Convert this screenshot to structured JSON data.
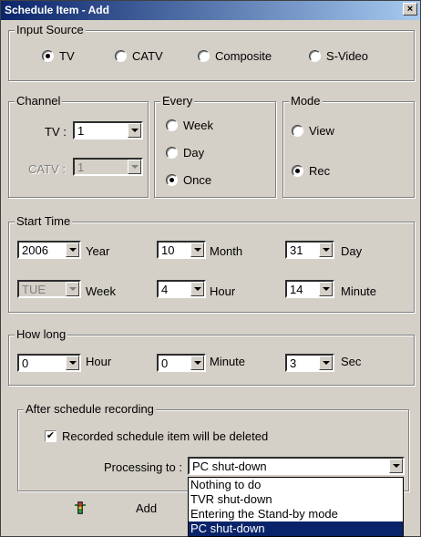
{
  "window": {
    "title": "Schedule Item - Add",
    "close_label": "×"
  },
  "input_source": {
    "legend": "Input Source",
    "options": [
      "TV",
      "CATV",
      "Composite",
      "S-Video"
    ],
    "selected": "TV"
  },
  "channel": {
    "legend": "Channel",
    "tv_label": "TV :",
    "tv_value": "1",
    "catv_label": "CATV :",
    "catv_value": "1"
  },
  "every": {
    "legend": "Every",
    "options": [
      "Week",
      "Day",
      "Once"
    ],
    "selected": "Once"
  },
  "mode": {
    "legend": "Mode",
    "options": [
      "View",
      "Rec"
    ],
    "selected": "Rec"
  },
  "start_time": {
    "legend": "Start Time",
    "year_value": "2006",
    "year_label": "Year",
    "month_value": "10",
    "month_label": "Month",
    "day_value": "31",
    "day_label": "Day",
    "week_value": "TUE",
    "week_label": "Week",
    "hour_value": "4",
    "hour_label": "Hour",
    "minute_value": "14",
    "minute_label": "Minute"
  },
  "how_long": {
    "legend": "How long",
    "hour_value": "0",
    "hour_label": "Hour",
    "minute_value": "0",
    "minute_label": "Minute",
    "sec_value": "3",
    "sec_label": "Sec"
  },
  "after": {
    "legend": "After schedule recording",
    "delete_checkbox_label": "Recorded schedule item will be deleted",
    "delete_checked": true,
    "processing_label": "Processing to :",
    "processing_value": "PC shut-down",
    "processing_options": [
      "Nothing to do",
      "TVR shut-down",
      "Entering the Stand-by mode",
      "PC shut-down"
    ]
  },
  "footer": {
    "add_label": "Add"
  }
}
